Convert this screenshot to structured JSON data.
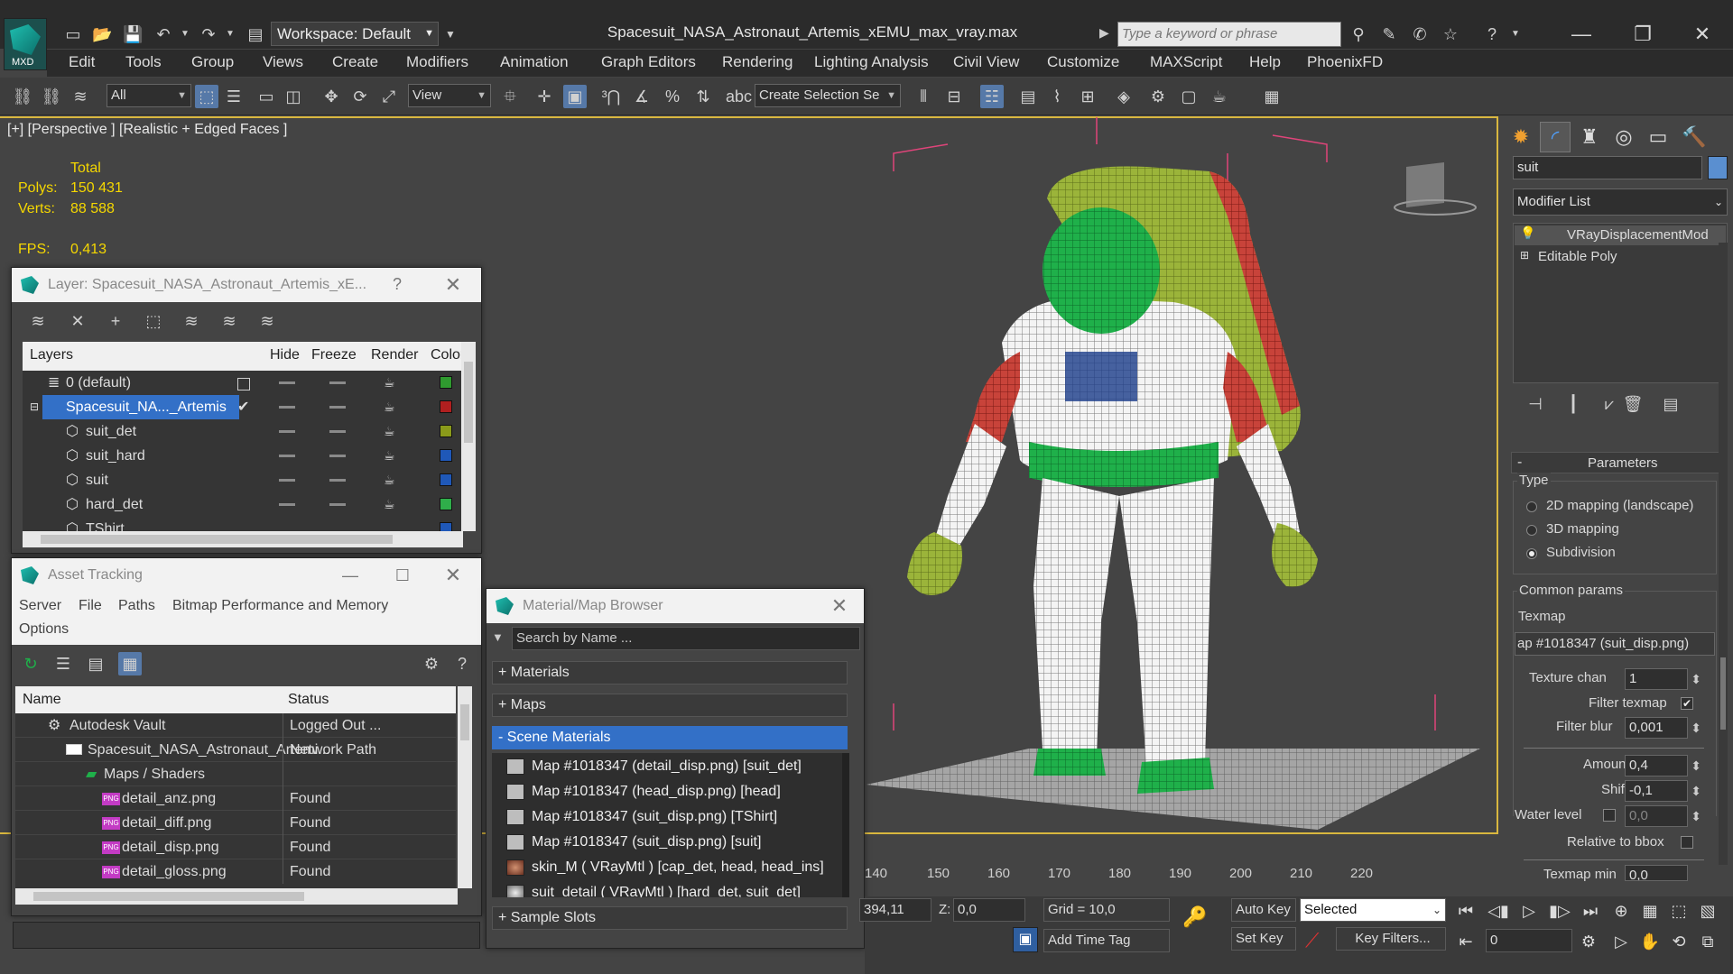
{
  "titlebar": {
    "logo_text": "MXD",
    "workspace": "Workspace: Default",
    "file_title": "Spacesuit_NASA_Astronaut_Artemis_xEMU_max_vray.max",
    "search_placeholder": "Type a keyword or phrase"
  },
  "menu": [
    "Edit",
    "Tools",
    "Group",
    "Views",
    "Create",
    "Modifiers",
    "Animation",
    "Graph Editors",
    "Rendering",
    "Lighting Analysis",
    "Civil View",
    "Customize",
    "MAXScript",
    "Help",
    "PhoenixFD"
  ],
  "toolbar": {
    "filter": "All",
    "ref_coord": "View",
    "selection_set": "Create Selection Se"
  },
  "viewport": {
    "label": "[+] [Perspective ] [Realistic + Edged Faces ]",
    "stats": {
      "total_label": "Total",
      "polys_label": "Polys:",
      "polys": "150 431",
      "verts_label": "Verts:",
      "verts": "88 588",
      "fps_label": "FPS:",
      "fps": "0,413"
    }
  },
  "layer_dialog": {
    "title": "Layer: Spacesuit_NASA_Astronaut_Artemis_xE...",
    "help": "?",
    "columns": [
      "Layers",
      "Hide",
      "Freeze",
      "Render",
      "Color"
    ],
    "rows": [
      {
        "name": "0 (default)",
        "color": "#2f9a2f",
        "indent": 1,
        "selected": false
      },
      {
        "name": "Spacesuit_NA..._Artemis",
        "color": "#b01f1f",
        "indent": 0,
        "selected": true
      },
      {
        "name": "suit_det",
        "color": "#8a9a1a",
        "indent": 2,
        "selected": false
      },
      {
        "name": "suit_hard",
        "color": "#1f58b8",
        "indent": 2,
        "selected": false
      },
      {
        "name": "suit",
        "color": "#1f58b8",
        "indent": 2,
        "selected": false
      },
      {
        "name": "hard_det",
        "color": "#2fae4a",
        "indent": 2,
        "selected": false
      },
      {
        "name": "TShirt",
        "color": "#1f58b8",
        "indent": 2,
        "selected": false
      }
    ]
  },
  "asset_dialog": {
    "title": "Asset Tracking",
    "menu": [
      "Server",
      "File",
      "Paths",
      "Bitmap Performance and Memory",
      "Options"
    ],
    "columns": [
      "Name",
      "Status"
    ],
    "rows": [
      {
        "name": "Autodesk Vault",
        "status": "Logged Out ...",
        "indent": 1,
        "icon": "vault"
      },
      {
        "name": "Spacesuit_NASA_Astronaut_Artemi...",
        "status": "Network Path",
        "indent": 2,
        "icon": "file"
      },
      {
        "name": "Maps / Shaders",
        "status": "",
        "indent": 3,
        "icon": "maps"
      },
      {
        "name": "detail_anz.png",
        "status": "Found",
        "indent": 4,
        "icon": "png"
      },
      {
        "name": "detail_diff.png",
        "status": "Found",
        "indent": 4,
        "icon": "png"
      },
      {
        "name": "detail_disp.png",
        "status": "Found",
        "indent": 4,
        "icon": "png"
      },
      {
        "name": "detail_gloss.png",
        "status": "Found",
        "indent": 4,
        "icon": "png"
      }
    ]
  },
  "material_browser": {
    "title": "Material/Map Browser",
    "search_placeholder": "Search by Name ...",
    "groups": [
      "+ Materials",
      "+ Maps",
      "- Scene Materials",
      "+ Sample Slots"
    ],
    "items": [
      "Map #1018347 (detail_disp.png) [suit_det]",
      "Map #1018347 (head_disp.png) [head]",
      "Map #1018347 (suit_disp.png) [TShirt]",
      "Map #1018347 (suit_disp.png) [suit]",
      "skin_M  ( VRayMtl )  [cap_det, head, head_ins]",
      "suit_detail  ( VRayMtl )  [hard_det, suit_det]"
    ]
  },
  "command_panel": {
    "object_name": "suit",
    "modifier_list": "Modifier List",
    "stack": [
      "VRayDisplacementMod",
      "Editable Poly"
    ],
    "rollout_title": "Parameters",
    "type_label": "Type",
    "type_options": [
      "2D mapping (landscape)",
      "3D mapping",
      "Subdivision"
    ],
    "type_selected": 2,
    "common_label": "Common params",
    "texmap_label": "Texmap",
    "texmap_value": "ap #1018347 (suit_disp.png)",
    "texture_chan_label": "Texture chan",
    "texture_chan": "1",
    "filter_texmap_label": "Filter texmap",
    "filter_blur_label": "Filter blur",
    "filter_blur": "0,001",
    "amount_label": "Amount",
    "amount": "0,4",
    "shift_label": "Shift",
    "shift": "-0,1",
    "water_level_label": "Water level",
    "water_level": "0,0",
    "relative_label": "Relative to bbox",
    "texmap_min_label": "Texmap min",
    "texmap_min": "0,0"
  },
  "timeline": {
    "ticks": [
      "140",
      "150",
      "160",
      "170",
      "180",
      "190",
      "200",
      "210",
      "220"
    ]
  },
  "statusbar": {
    "x_value": "394,11",
    "z_label": "Z:",
    "z_value": "0,0",
    "grid": "Grid = 10,0",
    "add_time_tag": "Add Time Tag",
    "auto_key": "Auto Key",
    "set_key": "Set Key",
    "selected": "Selected",
    "key_filters": "Key Filters...",
    "frame": "0"
  },
  "colors": {
    "accent": "#3370c7",
    "viewport_border": "#d9b73f",
    "stats": "#f5d700"
  }
}
